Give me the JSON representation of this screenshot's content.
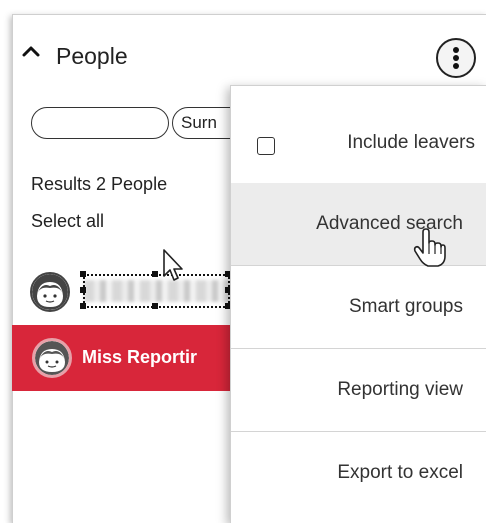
{
  "section": {
    "title": "People",
    "chevron_icon": "chevron-up-icon",
    "more_icon": "kebab-vertical-icon"
  },
  "filters": {
    "first_name_value": "",
    "surname_value": "Surn"
  },
  "results_text": "Results 2 People",
  "select_all_label": "Select all",
  "people": [
    {
      "name": "",
      "avatar_icon": "person-avatar-icon",
      "selected": false
    },
    {
      "name": "Miss Reportir",
      "avatar_icon": "person-avatar-icon",
      "selected": true
    }
  ],
  "menu": {
    "items": [
      {
        "label": "Include leavers",
        "type": "checkbox",
        "checked": false
      },
      {
        "label": "Advanced search",
        "type": "item",
        "hovered": true
      },
      {
        "label": "Smart groups",
        "type": "item"
      },
      {
        "label": "Reporting view",
        "type": "item"
      },
      {
        "label": "Export to excel",
        "type": "item"
      }
    ]
  },
  "colors": {
    "selected_row": "#d8263a",
    "hover_item": "#ececec"
  }
}
